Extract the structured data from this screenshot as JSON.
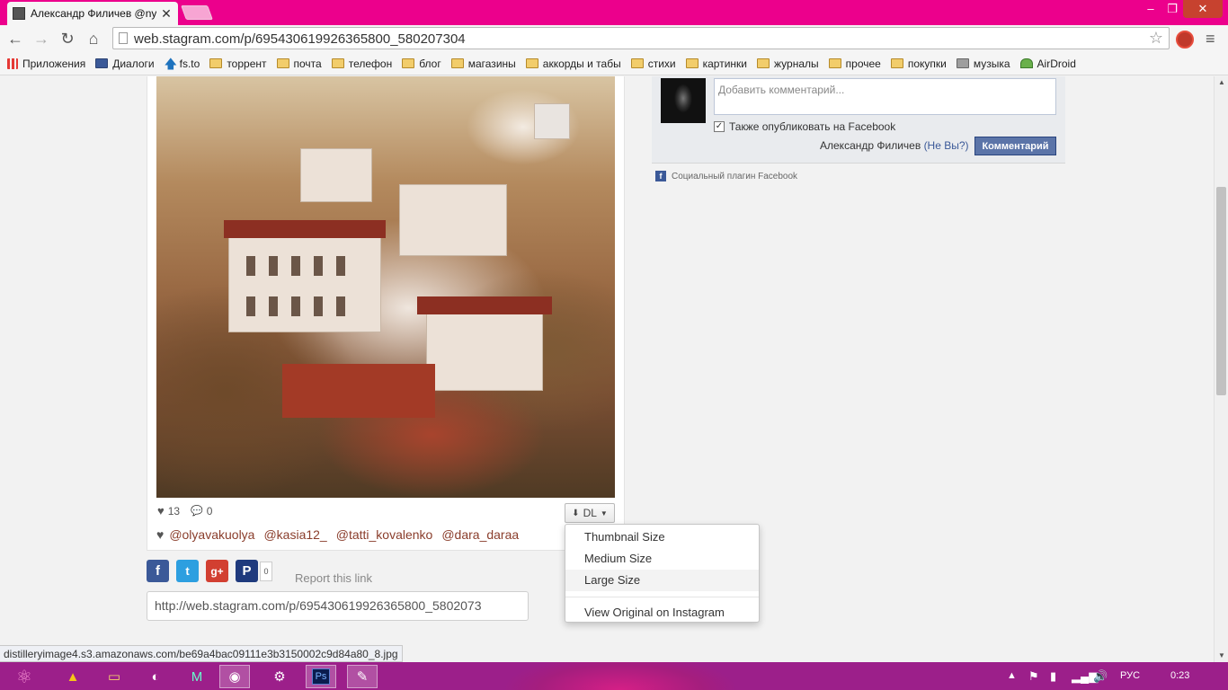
{
  "browser": {
    "tab_title": "Александр Филичев @ny",
    "url": "web.stagram.com/p/695430619926365800_580207304",
    "window_controls": {
      "minimize": "–",
      "maximize": "❐",
      "close": "✕"
    }
  },
  "bookmarks": [
    {
      "label": "Приложения",
      "icon": "apps-icon"
    },
    {
      "label": "Диалоги",
      "icon": "dialogs-icon"
    },
    {
      "label": "fs.to",
      "icon": "arrow-up-icon"
    },
    {
      "label": "торрент",
      "icon": "folder-icon"
    },
    {
      "label": "почта",
      "icon": "folder-icon"
    },
    {
      "label": "телефон",
      "icon": "folder-icon"
    },
    {
      "label": "блог",
      "icon": "folder-icon"
    },
    {
      "label": "магазины",
      "icon": "folder-icon"
    },
    {
      "label": "аккорды и табы",
      "icon": "folder-icon"
    },
    {
      "label": "стихи",
      "icon": "folder-icon"
    },
    {
      "label": "картинки",
      "icon": "folder-icon"
    },
    {
      "label": "журналы",
      "icon": "folder-icon"
    },
    {
      "label": "прочее",
      "icon": "folder-icon"
    },
    {
      "label": "покупки",
      "icon": "folder-icon"
    },
    {
      "label": "музыка",
      "icon": "music-icon"
    },
    {
      "label": "AirDroid",
      "icon": "airdroid-icon"
    }
  ],
  "post": {
    "likes_count": "13",
    "comments_count": "0",
    "dl_label": "DL",
    "likers": [
      "@olyavakuolya",
      "@kasia12_",
      "@tatti_kovalenko",
      "@dara_daraa"
    ],
    "share_count": "0",
    "report_label": "Report this link",
    "permalink": "http://web.stagram.com/p/695430619926365800_5802073"
  },
  "download_menu": {
    "items": [
      "Thumbnail Size",
      "Medium Size",
      "Large Size"
    ],
    "original": "View Original on Instagram",
    "hovered_index": 2
  },
  "comments": {
    "placeholder": "Добавить комментарий...",
    "facebook_checkbox_label": "Также опубликовать на Facebook",
    "facebook_checked": true,
    "author": "Александр Филичев",
    "not_you": "(Не Вы?)",
    "submit_label": "Комментарий",
    "plugin_label": "Социальный плагин Facebook"
  },
  "status_bar": "distilleryimage4.s3.amazonaws.com/be69a4bac09111e3b3150002c9d84a80_8.jpg",
  "taskbar": {
    "language": "РУС",
    "clock": "0:23",
    "ps_label": "Ps"
  },
  "colors": {
    "titlebar": "#ec008c",
    "taskbar": "#9c1f8a",
    "liker_link": "#8a3d2b",
    "facebook_blue": "#3b5998"
  }
}
